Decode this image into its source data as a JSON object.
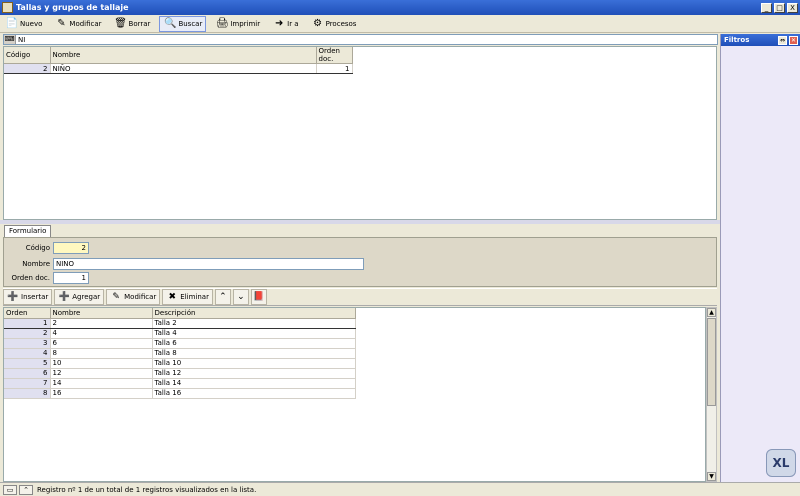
{
  "window": {
    "title": "Tallas y grupos de tallaje",
    "controls": [
      "_",
      "□",
      "X"
    ]
  },
  "toolbar": [
    {
      "label": "Nuevo",
      "icon": "new-icon"
    },
    {
      "label": "Modificar",
      "icon": "edit-icon"
    },
    {
      "label": "Borrar",
      "icon": "delete-icon"
    },
    {
      "label": "Buscar",
      "icon": "search-icon",
      "active": true
    },
    {
      "label": "Imprimir",
      "icon": "print-icon"
    },
    {
      "label": "Ir a",
      "icon": "goto-icon"
    },
    {
      "label": "Procesos",
      "icon": "process-icon"
    }
  ],
  "search": {
    "value": "NI"
  },
  "grid1": {
    "headers": [
      "Código",
      "Nombre",
      "Orden doc."
    ],
    "rows": [
      {
        "codigo": "2",
        "nombre": "NIÑO",
        "orden": "1"
      }
    ]
  },
  "tabs": [
    {
      "label": "Formulario"
    }
  ],
  "form": {
    "codigo_label": "Código",
    "codigo_value": "2",
    "nombre_label": "Nombre",
    "nombre_value": "NIÑO",
    "orden_label": "Orden doc.",
    "orden_value": "1"
  },
  "toolbar2": {
    "insertar": "Insertar",
    "agregar": "Agregar",
    "modificar": "Modificar",
    "eliminar": "Eliminar"
  },
  "grid2": {
    "headers": [
      "Orden",
      "Nombre",
      "Descripción"
    ],
    "rows": [
      {
        "orden": "1",
        "nombre": "2",
        "descripcion": "Talla 2"
      },
      {
        "orden": "2",
        "nombre": "4",
        "descripcion": "Talla 4"
      },
      {
        "orden": "3",
        "nombre": "6",
        "descripcion": "Talla 6"
      },
      {
        "orden": "4",
        "nombre": "8",
        "descripcion": "Talla 8"
      },
      {
        "orden": "5",
        "nombre": "10",
        "descripcion": "Talla 10"
      },
      {
        "orden": "6",
        "nombre": "12",
        "descripcion": "Talla 12"
      },
      {
        "orden": "7",
        "nombre": "14",
        "descripcion": "Talla 14"
      },
      {
        "orden": "8",
        "nombre": "16",
        "descripcion": "Talla 16"
      }
    ]
  },
  "status": {
    "text": "Registro nº 1 de un total de 1 registros visualizados en la lista."
  },
  "filters": {
    "title": "Filtros"
  },
  "logo": {
    "text": "XL"
  }
}
